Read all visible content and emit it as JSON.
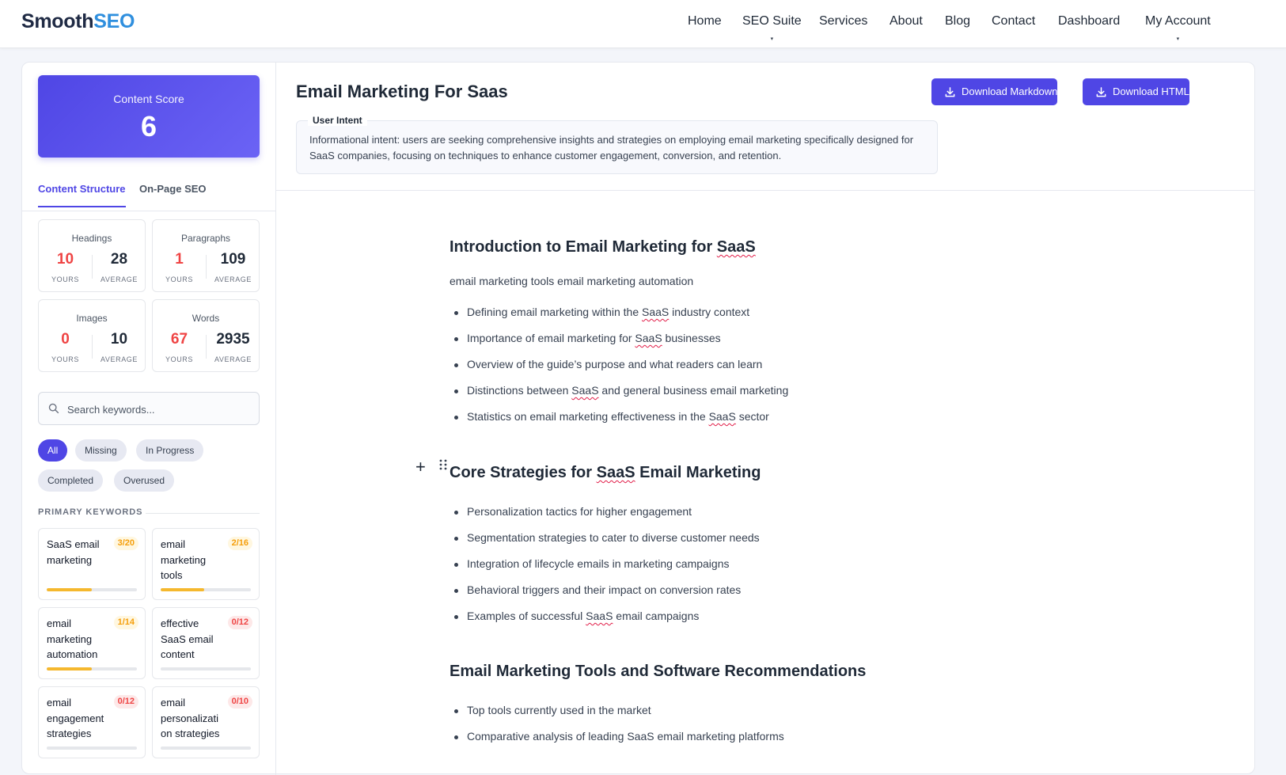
{
  "brand": {
    "part1": "Smooth",
    "part2": "SEO"
  },
  "nav": [
    {
      "label": "Home"
    },
    {
      "label": "SEO Suite",
      "caret": "▾"
    },
    {
      "label": "Services"
    },
    {
      "label": "About"
    },
    {
      "label": "Blog"
    },
    {
      "label": "Contact"
    },
    {
      "label": "Dashboard"
    },
    {
      "label": "My Account",
      "caret": "▾"
    }
  ],
  "score": {
    "label": "Content Score",
    "value": "6"
  },
  "tabs": [
    {
      "label": "Content Structure",
      "active": true
    },
    {
      "label": "On-Page SEO",
      "active": false
    }
  ],
  "stats": [
    {
      "title": "Headings",
      "yours": "10",
      "average": "28"
    },
    {
      "title": "Paragraphs",
      "yours": "1",
      "average": "109"
    },
    {
      "title": "Images",
      "yours": "0",
      "average": "10"
    },
    {
      "title": "Words",
      "yours": "67",
      "average": "2935"
    }
  ],
  "stat_captions": {
    "yours": "YOURS",
    "average": "AVERAGE"
  },
  "search": {
    "placeholder": "Search keywords..."
  },
  "filters": [
    {
      "label": "All",
      "active": true
    },
    {
      "label": "Missing"
    },
    {
      "label": "In Progress"
    },
    {
      "label": "Completed"
    },
    {
      "label": "Overused"
    }
  ],
  "primary_keywords_label": "PRIMARY KEYWORDS",
  "keywords": [
    {
      "name": "SaaS email marketing",
      "count": "3/20",
      "progress": 0.5,
      "status": "partial"
    },
    {
      "name": "email marketing tools",
      "count": "2/16",
      "progress": 0.48,
      "status": "partial"
    },
    {
      "name": "email marketing automation",
      "count": "1/14",
      "progress": 0.5,
      "status": "partial"
    },
    {
      "name": "effective SaaS email content",
      "count": "0/12",
      "progress": 0,
      "status": "missing"
    },
    {
      "name": "email engagement strategies",
      "count": "0/12",
      "progress": 0,
      "status": "missing"
    },
    {
      "name": "email personalizati on strategies",
      "count": "0/10",
      "progress": 0,
      "status": "missing"
    }
  ],
  "document": {
    "title": "Email Marketing For Saas",
    "download_markdown": "Download Markdown",
    "download_html": "Download HTML",
    "user_intent_label": "User Intent",
    "user_intent_text": "Informational intent: users are seeking comprehensive insights and strategies on employing email marketing specifically designed for SaaS companies, focusing on techniques to enhance customer engagement, conversion, and retention."
  },
  "sections": [
    {
      "heading": [
        "Introduction to Email Marketing for ",
        {
          "sq": "SaaS"
        }
      ],
      "paragraph": "email marketing tools email marketing automation",
      "items": [
        [
          "Defining email marketing within the ",
          {
            "sq": "SaaS"
          },
          " industry context"
        ],
        [
          "Importance of email marketing for ",
          {
            "sq": "SaaS"
          },
          " businesses"
        ],
        [
          "Overview of the guide’s purpose and what readers can learn"
        ],
        [
          "Distinctions between ",
          {
            "sq": "SaaS"
          },
          " and general business email marketing"
        ],
        [
          "Statistics on email marketing effectiveness in the ",
          {
            "sq": "SaaS"
          },
          " sector"
        ]
      ]
    },
    {
      "heading": [
        "Core Strategies for ",
        {
          "sq": "SaaS"
        },
        " Email Marketing"
      ],
      "items": [
        [
          "Personalization tactics for higher engagement"
        ],
        [
          "Segmentation strategies to cater to diverse customer needs"
        ],
        [
          "Integration of lifecycle emails in marketing campaigns"
        ],
        [
          "Behavioral triggers and their impact on conversion rates"
        ],
        [
          "Examples of successful ",
          {
            "sq": "SaaS"
          },
          " email campaigns"
        ]
      ]
    },
    {
      "heading": [
        "Email Marketing Tools and Software Recommendations"
      ],
      "items": [
        [
          "Top tools currently used in the market"
        ],
        [
          "Comparative analysis of leading SaaS email marketing platforms"
        ]
      ]
    }
  ],
  "colors": {
    "accent": "#4f46e5",
    "brand_blue": "#2f8fde",
    "warning": "#f59e0b",
    "danger": "#ef4444"
  },
  "icons": {
    "search": "search-icon",
    "download": "download-icon",
    "add": "plus-icon",
    "drag": "drag-handle-icon"
  }
}
